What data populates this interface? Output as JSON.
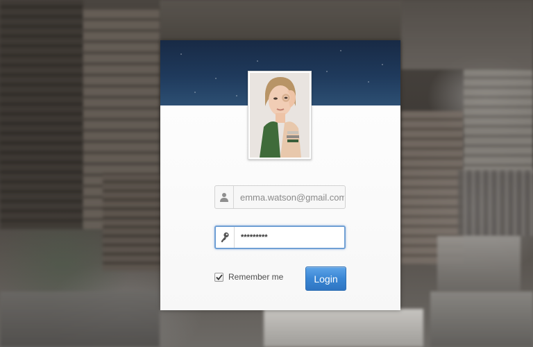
{
  "login_form": {
    "avatar_alt": "User avatar photo",
    "email": {
      "value": "emma.watson@gmail.com",
      "icon": "user-icon"
    },
    "password": {
      "value": "*********",
      "icon": "key-icon"
    },
    "remember_me": {
      "label": "Remember me",
      "checked": true
    },
    "login_button": {
      "label": "Login"
    }
  },
  "colors": {
    "header_top": "#182a45",
    "header_bottom": "#2d4f73",
    "button": "#3a86d4",
    "focus_border": "#6f9fd4"
  }
}
